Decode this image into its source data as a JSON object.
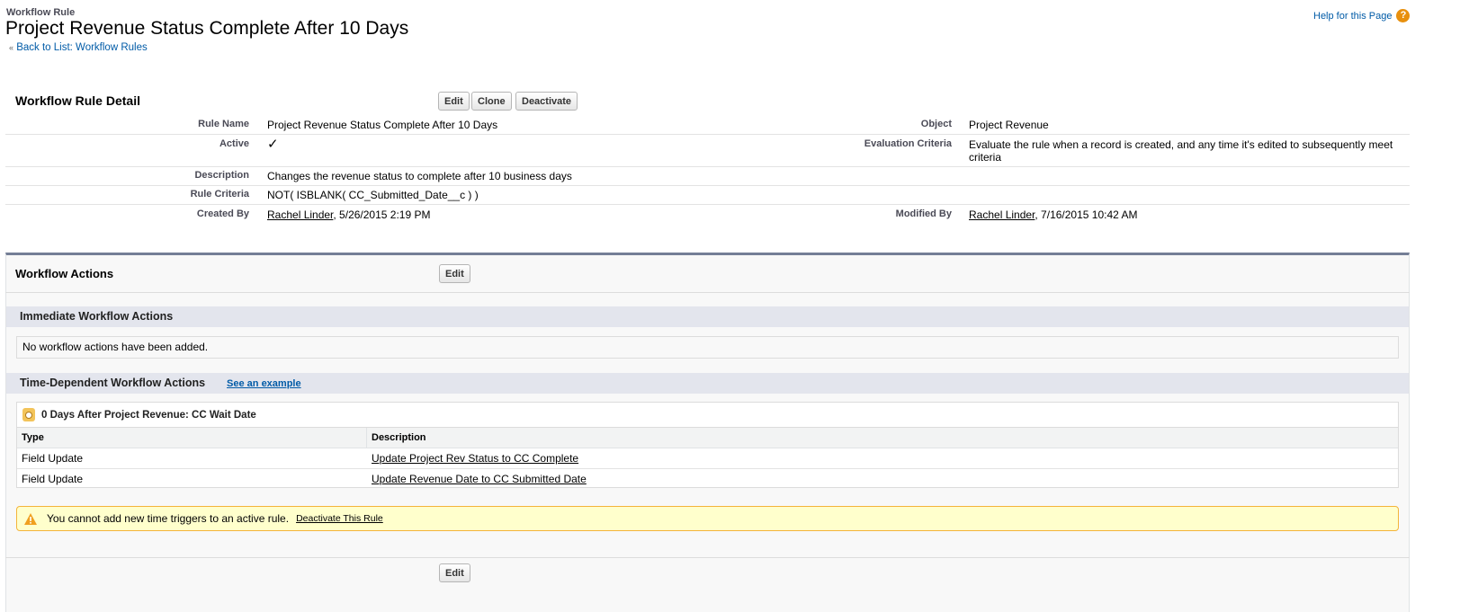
{
  "header": {
    "type": "Workflow Rule",
    "title": "Project Revenue Status Complete After 10 Days",
    "back_link": "Back to List: Workflow Rules",
    "back_prefix": "«",
    "help": "Help for this Page"
  },
  "detail": {
    "title": "Workflow Rule Detail",
    "buttons": [
      "Edit",
      "Clone",
      "Deactivate"
    ],
    "fields": {
      "rule_name_label": "Rule Name",
      "rule_name": "Project Revenue Status Complete After 10 Days",
      "object_label": "Object",
      "object": "Project Revenue",
      "active_label": "Active",
      "active_check": "✓",
      "eval_label": "Evaluation Criteria",
      "eval": "Evaluate the rule when a record is created, and any time it's edited to subsequently meet criteria",
      "desc_label": "Description",
      "desc": "Changes the revenue status to complete after 10 business days",
      "criteria_label": "Rule Criteria",
      "criteria": "NOT( ISBLANK( CC_Submitted_Date__c ) )",
      "created_label": "Created By",
      "created_by": "Rachel Linder",
      "created_date": ", 5/26/2015 2:19 PM",
      "modified_label": "Modified By",
      "modified_by": "Rachel Linder",
      "modified_date": ", 7/16/2015 10:42 AM"
    }
  },
  "actions": {
    "title": "Workflow Actions",
    "edit": "Edit",
    "immediate_title": "Immediate Workflow Actions",
    "immediate_empty": "No workflow actions have been added.",
    "time_title": "Time-Dependent Workflow Actions",
    "see_example": "See an example",
    "trigger": "0 Days After Project Revenue: CC Wait Date",
    "columns": [
      "Type",
      "Description"
    ],
    "rows": [
      {
        "type": "Field Update",
        "desc": "Update Project Rev Status to CC Complete"
      },
      {
        "type": "Field Update",
        "desc": "Update Revenue Date to CC Submitted Date"
      }
    ],
    "warning": "You cannot add new time triggers to an active rule.",
    "warning_link": "Deactivate This Rule",
    "bottom_edit": "Edit"
  },
  "colors": {
    "link": "#015ba7",
    "band": "#e3e5ed",
    "warning_bg": "#ffffcc",
    "warning_border": "#f4b43a"
  }
}
